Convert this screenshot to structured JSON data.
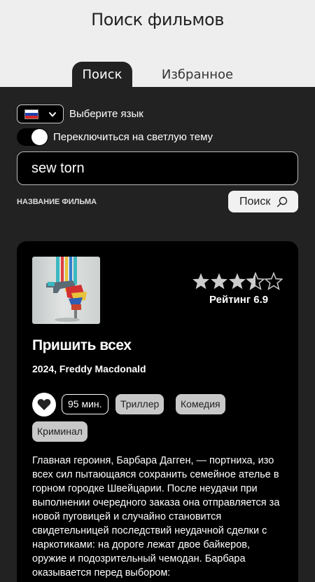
{
  "header": {
    "title": "Поиск фильмов",
    "tabs": [
      {
        "label": "Поиск",
        "active": true
      },
      {
        "label": "Избранное",
        "active": false
      }
    ]
  },
  "settings": {
    "language_flag": "russia-flag-icon",
    "language_label": "Выберите язык",
    "theme_toggle_label": "Переключиться на светлую тему"
  },
  "search": {
    "value": "sew torn",
    "field_caption": "НАЗВАНИЕ ФИЛЬМА",
    "button_label": "Поиск",
    "button_icon": "search-icon"
  },
  "movie": {
    "title": "Пришить всех",
    "year_director": "2024, Freddy Macdonald",
    "rating": 3.5,
    "rating_max": 5,
    "rating_text": "Рейтинг 6.9",
    "duration": "95 мин.",
    "genres": [
      "Триллер",
      "Комедия",
      "Криминал"
    ],
    "description": "Главная героиня, Барбара Дагген, — портниха, изо всех сил пытающаяся сохранить семейное ателье в горном городке Швейцарии. После неудачи при выполнении очередного заказа она отправляется за новой пуговицей и случайно становится свидетельницей последствий неудачной сделки с наркотиками: на дороге лежат двое байкеров, оружие и подозрительный чемодан. Барбара оказывается перед выбором:"
  },
  "colors": {
    "background": "#222222",
    "header_background": "#eeeeee",
    "card_background": "#000000",
    "star_color": "#cccccc",
    "genre_background": "#c8c8c8"
  }
}
